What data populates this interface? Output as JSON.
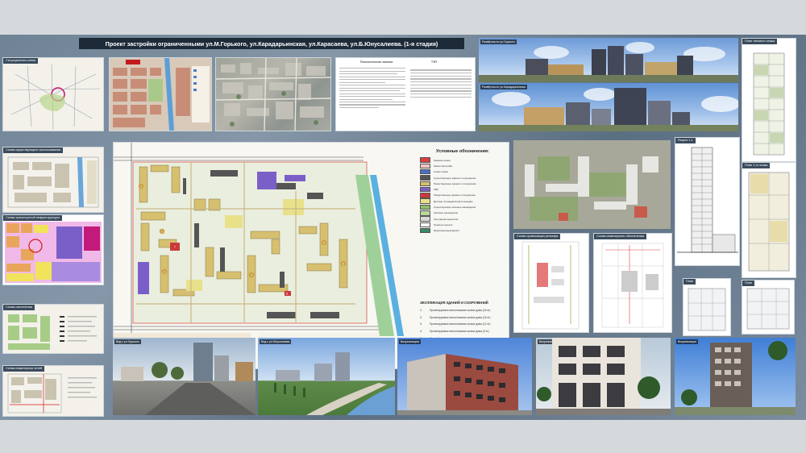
{
  "board": {
    "title": "Проект застройки ограниченными ул.М.Горького, ул.Карадарьинская, ул.Карасаева, ул.Б.Юнусалиева.          (1-я стадия)"
  },
  "legend": {
    "title": "Условные обозначения:",
    "items": [
      {
        "label": "Красная линия",
        "color": "#d94040"
      },
      {
        "label": "Линия застройки",
        "color": "#f2c6c6"
      },
      {
        "label": "Синяя линия",
        "color": "#4a6ec8"
      },
      {
        "label": "Существующие здания и сооружения",
        "color": "#555555"
      },
      {
        "label": "Проектируемые здания и сооружения",
        "color": "#d6c070"
      },
      {
        "label": "СБК",
        "color": "#7b5fc9"
      },
      {
        "label": "Общественные здания и сооружения",
        "color": "#c93a3a"
      },
      {
        "label": "Детские площадки/спортплощадки",
        "color": "#e9e08a"
      },
      {
        "label": "Существующие зелёные насаждения",
        "color": "#8bbf6a"
      },
      {
        "label": "Зелёные насаждения",
        "color": "#b7d99a"
      },
      {
        "label": "Тротуарная вымостка",
        "color": "#d9d9d9"
      },
      {
        "label": "Граница проекта",
        "color": "#ffffff"
      },
      {
        "label": "Ирригационные/арыки",
        "color": "#3a8a6a"
      }
    ]
  },
  "explication": {
    "title": "ЭКСПЛИКАЦИЯ ЗДАНИЙ И СООРУЖЕНИЙ",
    "rows": [
      {
        "num": "1.",
        "text": "Проектируемые многоэтажные жилые дома (16 эт)"
      },
      {
        "num": "2.",
        "text": "Проектируемые многоэтажные жилые дома (16 эт)"
      },
      {
        "num": "3.",
        "text": "Проектируемые многоэтажные жилые дома (12 эт)"
      },
      {
        "num": "4.",
        "text": "Проектируемые многоэтажные жилые дома (9 эт)"
      },
      {
        "num": "5.",
        "text": "Детский сад"
      },
      {
        "num": "6.",
        "text": "Существующие здания и сооружения"
      },
      {
        "num": "7.",
        "text": "Проектируемые общественные здания и сооружения"
      }
    ]
  },
  "panels": {
    "situation": "Ситуационная схема",
    "zoning": "Схема функционального зонирования",
    "satellite": "Опорный план",
    "note": "Пояснительная записка",
    "teps": "ТЭП",
    "panorama1": "Развёртка по ул.Горького",
    "panorama2": "Развёртка по ул.Карадарьинская",
    "floorplan1": "План типового этажа",
    "floorplan2": "План 1-го этажа",
    "left1": "Схема существующего использования",
    "left2": "Схема транспортной инфраструктуры",
    "left3": "Схема озеленения",
    "left4": "Схема инженерных сетей",
    "aerial": "Перспективный вид",
    "section": "Разрез 1-1",
    "site1": "Схема организации рельефа",
    "site2": "Схема инженерного обеспечения",
    "small1": "План",
    "small2": "План",
    "v1": "Вид с ул.Горького",
    "v2": "Вид с ул.Юнусалиева",
    "v3": "Визуализация",
    "v4": "Визуализация",
    "v5": "Визуализация"
  },
  "markers": [
    "1",
    "2",
    "3",
    "4",
    "5",
    "6",
    "7",
    "8"
  ],
  "colors": {
    "board": "#6f8396",
    "title_bg": "#1d2b39"
  }
}
